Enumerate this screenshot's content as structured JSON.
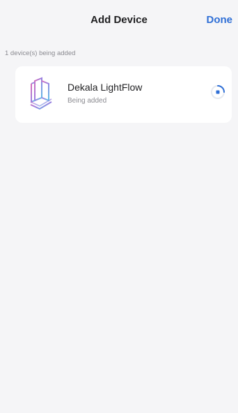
{
  "header": {
    "title": "Add Device",
    "done_label": "Done"
  },
  "section": {
    "caption": "1 device(s) being added"
  },
  "devices": [
    {
      "name": "Dekala LightFlow",
      "status": "Being added",
      "icon": "lightflow-logo-icon",
      "progress_icon": "loading-spinner-icon"
    }
  ],
  "colors": {
    "accent": "#2f6fd6",
    "background": "#f5f5f7",
    "card": "#ffffff",
    "text_primary": "#1f1f21",
    "text_secondary": "#8a8a90"
  }
}
